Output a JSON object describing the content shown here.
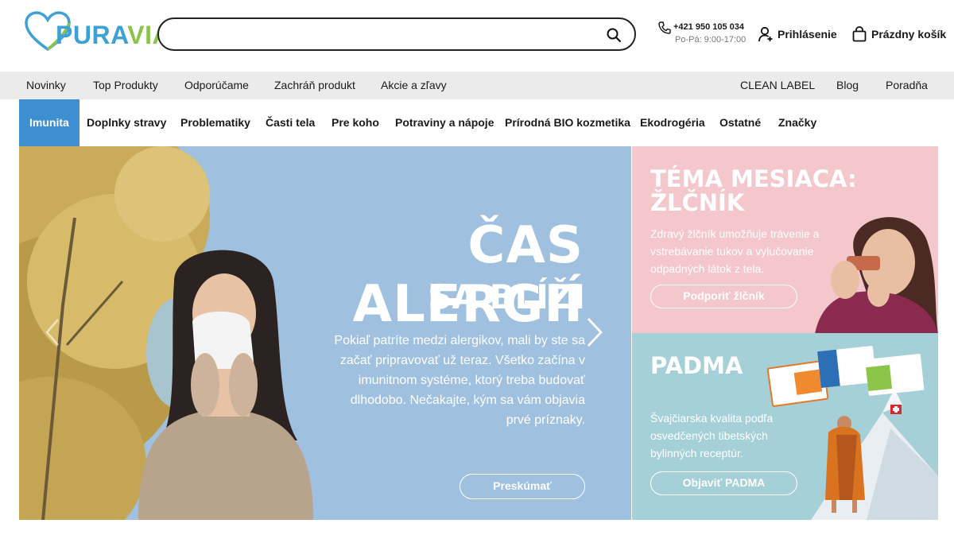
{
  "header": {
    "logo_text_left": "PURA",
    "logo_text_right": "VIA",
    "search_placeholder": "",
    "phone_number": "+421 950 105 034",
    "phone_hours": "Po-Pá: 9:00-17:00",
    "login_label": "Prihlásenie",
    "cart_label": "Prázdny košík"
  },
  "topnav": {
    "left": [
      "Novinky",
      "Top Produkty",
      "Odporúčame",
      "Zachráň produkt",
      "Akcie a zľavy"
    ],
    "right": [
      "CLEAN LABEL",
      "Blog",
      "Poradňa"
    ]
  },
  "categories": [
    "Imunita",
    "Doplnky stravy",
    "Problematiky",
    "Časti tela",
    "Pre koho",
    "Potraviny a nápoje",
    "Prírodná BIO kozmetika",
    "Ekodrogéria",
    "Ostatné",
    "Značky"
  ],
  "hero": {
    "title": "ČAS ALERGIÍ",
    "subtitle": "SA BLÍŽI",
    "text": "Pokiaľ patríte medzi alergikov, mali by ste sa začať pripravovať už teraz. Všetko začína v imunitnom systéme, ktorý treba budovať dlhodobo. Nečakajte, kým sa vám objavia prvé príznaky.",
    "button": "Preskúmať"
  },
  "promo_top": {
    "title": "TÉMA MESIACA: ŽLČNÍK",
    "text": "Zdravý žlčník umožňuje trávenie a vstrebávanie tukov a vylučovanie odpadných látok z tela.",
    "button": "Podporiť žlčník"
  },
  "promo_bottom": {
    "title": "PADMA",
    "text": "Švajčiarska kvalita podľa osvedčených tibetských bylinných receptúr.",
    "button": "Objaviť PADMA"
  },
  "colors": {
    "brand_blue": "#3ea1d6",
    "brand_green": "#8cc44a",
    "active_category": "#3e8fd1",
    "hero_bg": "#9fc0df",
    "promo_pink": "#f3c7cb",
    "promo_teal": "#a5d0d7"
  }
}
